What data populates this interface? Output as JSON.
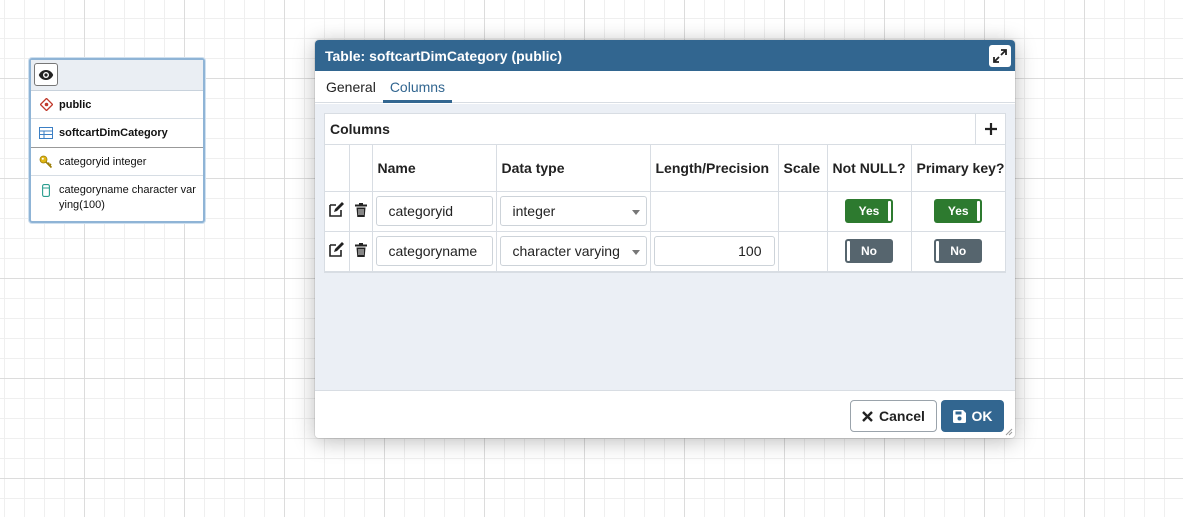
{
  "erd": {
    "schema": "public",
    "table": "softcartDimCategory",
    "columns": [
      {
        "label": "categoryid integer"
      },
      {
        "label_line1": "categoryname character var",
        "label_line2": "ying(100)"
      }
    ]
  },
  "dialog": {
    "title": "Table: softcartDimCategory (public)",
    "tabs": [
      "General",
      "Columns"
    ],
    "active_tab": "Columns",
    "grid_title": "Columns",
    "headers": [
      "Name",
      "Data type",
      "Length/Precision",
      "Scale",
      "Not NULL?",
      "Primary key?"
    ],
    "rows": [
      {
        "name": "categoryid",
        "type": "integer",
        "length": "",
        "scale": "",
        "not_null": "Yes",
        "primary_key": "Yes"
      },
      {
        "name": "categoryname",
        "type": "character varying",
        "length": "100",
        "scale": "",
        "not_null": "No",
        "primary_key": "No"
      }
    ],
    "cancel_label": "Cancel",
    "ok_label": "OK"
  },
  "colors": {
    "accent": "#326690",
    "toggle_on": "#2d7a2f",
    "toggle_off": "#56656e"
  },
  "icons": {
    "eye": "eye-icon",
    "schema": "schema-diamond-icon",
    "table": "table-icon",
    "pk": "key-icon",
    "column": "column-icon",
    "expand": "expand-icon",
    "add": "plus-icon",
    "edit": "edit-icon",
    "delete": "trash-icon",
    "cancel": "close-icon",
    "ok": "save-icon"
  }
}
